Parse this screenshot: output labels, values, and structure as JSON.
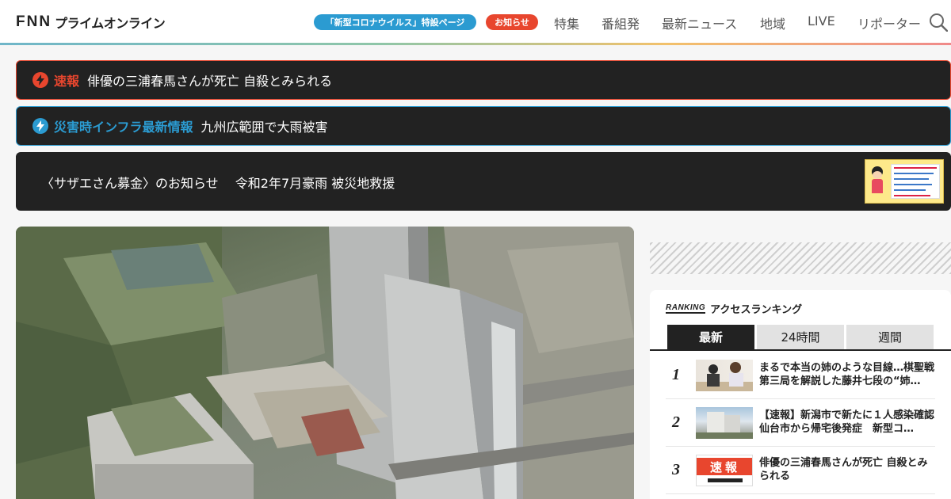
{
  "header": {
    "logo_mark": "FNN",
    "logo_text": "プライムオンライン",
    "pill_covid": "「新型コロナウイルス」特設ページ",
    "pill_news": "お知らせ",
    "nav": [
      "特集",
      "番組発",
      "最新ニュース",
      "地域",
      "LIVE",
      "リポーター"
    ]
  },
  "alerts": {
    "breaking": {
      "tag": "速報",
      "text": "俳優の三浦春馬さんが死亡 自殺とみられる"
    },
    "disaster": {
      "tag": "災害時インフラ最新情報",
      "text": "九州広範囲で大雨被害"
    }
  },
  "banner": {
    "text": "〈サザエさん募金〉のお知らせ　 令和2年7月豪雨 被災地救援"
  },
  "ranking": {
    "label_en": "RANKING",
    "title": "アクセスランキング",
    "tabs": [
      "最新",
      "24時間",
      "週間"
    ],
    "items": [
      {
        "rank": "1",
        "text": "まるで本当の姉のような目線…棋聖戦第三局を解説した藤井七段の“姉…"
      },
      {
        "rank": "2",
        "text": "【速報】新潟市で新たに１人感染確認　仙台市から帰宅後発症　新型コ…"
      },
      {
        "rank": "3",
        "text": "俳優の三浦春馬さんが死亡 自殺とみられる",
        "thumb_badge": "速報"
      }
    ]
  },
  "colors": {
    "accent_red": "#e8462e",
    "accent_blue": "#2b9bd1",
    "dark": "#222222"
  }
}
